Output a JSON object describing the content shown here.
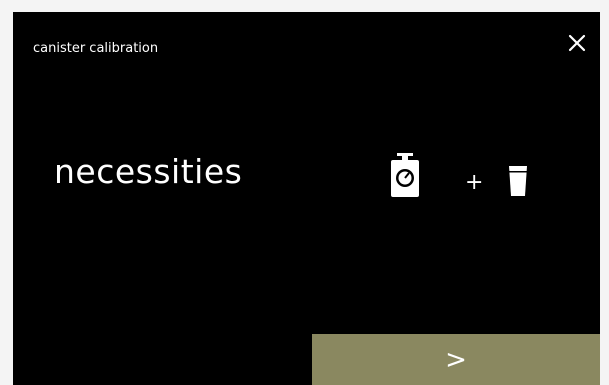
{
  "header": {
    "title": "canister calibration",
    "close_icon": "close-icon"
  },
  "main": {
    "headline": "necessities",
    "items": [
      {
        "icon": "scale-icon"
      },
      {
        "separator": "+"
      },
      {
        "icon": "cup-icon"
      }
    ]
  },
  "footer": {
    "next_label": ">",
    "next_color": "#8a8860"
  }
}
